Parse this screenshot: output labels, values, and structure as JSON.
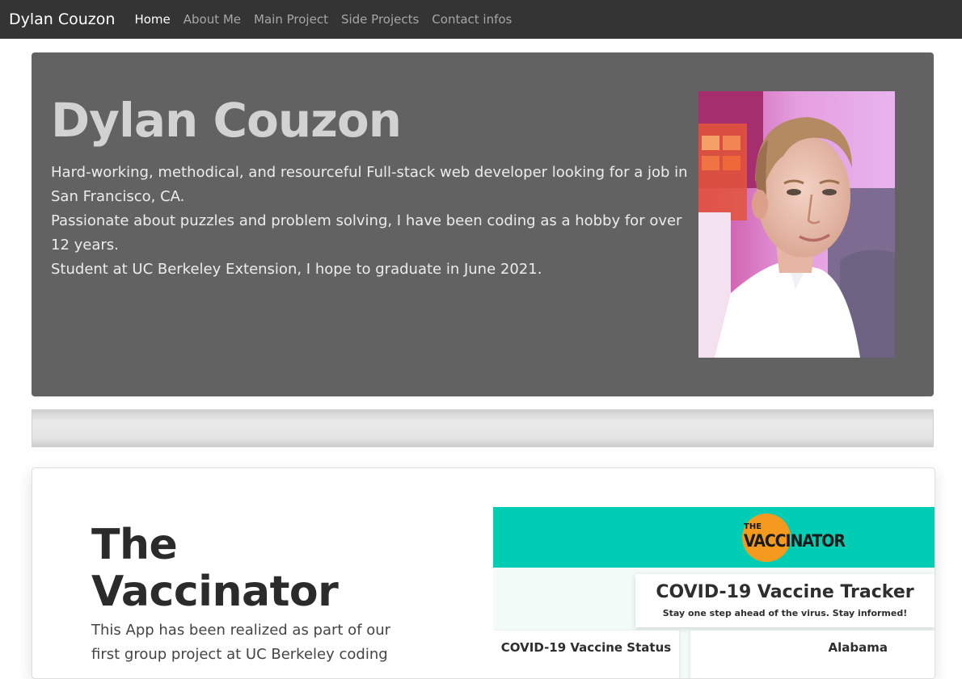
{
  "navbar": {
    "brand": "Dylan Couzon",
    "links": [
      "Home",
      "About Me",
      "Main Project",
      "Side Projects",
      "Contact infos"
    ],
    "active": "Home"
  },
  "hero": {
    "name": "Dylan Couzon",
    "paragraphs": [
      "Hard-working, methodical, and resourceful Full-stack web developer looking for a job in San Francisco, CA.",
      "Passionate about puzzles and problem solving, I have been coding as a hobby for over 12 years.",
      "Student at UC Berkeley Extension, I hope to graduate in June 2021."
    ]
  },
  "project": {
    "title": "The Vaccinator",
    "description": "This App has been realized as part of our first group project at UC Berkeley coding",
    "preview": {
      "logo_small": "THE",
      "logo_text": "VACCINATOR",
      "tracker_title": "COVID-19 Vaccine Tracker",
      "tracker_subtitle": "Stay one step ahead of the virus. Stay informed!",
      "status_title": "COVID-19 Vaccine Status",
      "state_title": "Alabama"
    }
  },
  "colors": {
    "navbar": "#343434",
    "hero_bg": "#636263",
    "preview_header": "#00cdb4",
    "logo_accent": "#f39a1f"
  }
}
